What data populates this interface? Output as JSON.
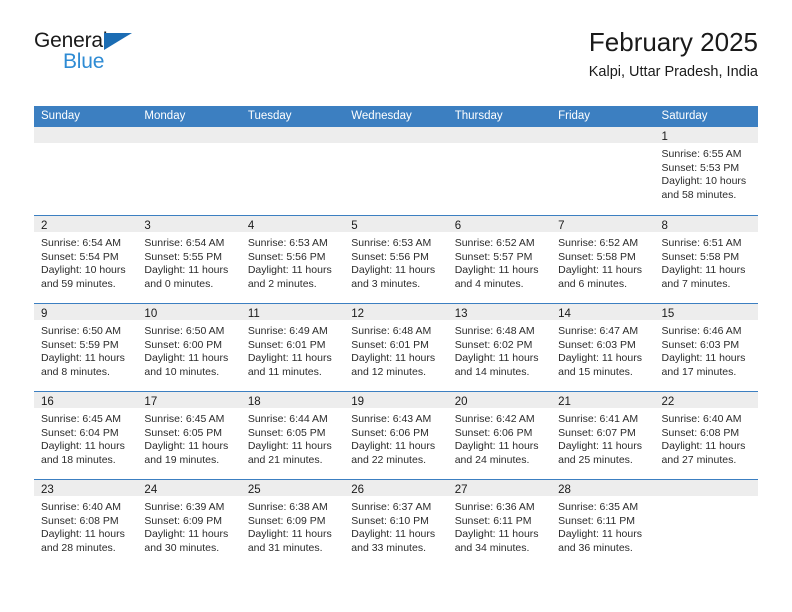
{
  "brand": {
    "name_part1": "General",
    "name_part2": "Blue",
    "triangle_icon": "blue-triangle-icon",
    "accent_color": "#2e8bd4",
    "dark_color": "#1a1a1a"
  },
  "header": {
    "title": "February 2025",
    "subtitle": "Kalpi, Uttar Pradesh, India"
  },
  "colors": {
    "header_bar": "#3c7fc1",
    "date_band": "#ededed",
    "week_divider": "#3c7fc1",
    "text": "#2b2b2b"
  },
  "weekdays": [
    "Sunday",
    "Monday",
    "Tuesday",
    "Wednesday",
    "Thursday",
    "Friday",
    "Saturday"
  ],
  "weeks": [
    [
      {
        "date": "",
        "sunrise": "",
        "sunset": "",
        "daylight_line1": "",
        "daylight_line2": ""
      },
      {
        "date": "",
        "sunrise": "",
        "sunset": "",
        "daylight_line1": "",
        "daylight_line2": ""
      },
      {
        "date": "",
        "sunrise": "",
        "sunset": "",
        "daylight_line1": "",
        "daylight_line2": ""
      },
      {
        "date": "",
        "sunrise": "",
        "sunset": "",
        "daylight_line1": "",
        "daylight_line2": ""
      },
      {
        "date": "",
        "sunrise": "",
        "sunset": "",
        "daylight_line1": "",
        "daylight_line2": ""
      },
      {
        "date": "",
        "sunrise": "",
        "sunset": "",
        "daylight_line1": "",
        "daylight_line2": ""
      },
      {
        "date": "1",
        "sunrise": "Sunrise: 6:55 AM",
        "sunset": "Sunset: 5:53 PM",
        "daylight_line1": "Daylight: 10 hours",
        "daylight_line2": "and 58 minutes."
      }
    ],
    [
      {
        "date": "2",
        "sunrise": "Sunrise: 6:54 AM",
        "sunset": "Sunset: 5:54 PM",
        "daylight_line1": "Daylight: 10 hours",
        "daylight_line2": "and 59 minutes."
      },
      {
        "date": "3",
        "sunrise": "Sunrise: 6:54 AM",
        "sunset": "Sunset: 5:55 PM",
        "daylight_line1": "Daylight: 11 hours",
        "daylight_line2": "and 0 minutes."
      },
      {
        "date": "4",
        "sunrise": "Sunrise: 6:53 AM",
        "sunset": "Sunset: 5:56 PM",
        "daylight_line1": "Daylight: 11 hours",
        "daylight_line2": "and 2 minutes."
      },
      {
        "date": "5",
        "sunrise": "Sunrise: 6:53 AM",
        "sunset": "Sunset: 5:56 PM",
        "daylight_line1": "Daylight: 11 hours",
        "daylight_line2": "and 3 minutes."
      },
      {
        "date": "6",
        "sunrise": "Sunrise: 6:52 AM",
        "sunset": "Sunset: 5:57 PM",
        "daylight_line1": "Daylight: 11 hours",
        "daylight_line2": "and 4 minutes."
      },
      {
        "date": "7",
        "sunrise": "Sunrise: 6:52 AM",
        "sunset": "Sunset: 5:58 PM",
        "daylight_line1": "Daylight: 11 hours",
        "daylight_line2": "and 6 minutes."
      },
      {
        "date": "8",
        "sunrise": "Sunrise: 6:51 AM",
        "sunset": "Sunset: 5:58 PM",
        "daylight_line1": "Daylight: 11 hours",
        "daylight_line2": "and 7 minutes."
      }
    ],
    [
      {
        "date": "9",
        "sunrise": "Sunrise: 6:50 AM",
        "sunset": "Sunset: 5:59 PM",
        "daylight_line1": "Daylight: 11 hours",
        "daylight_line2": "and 8 minutes."
      },
      {
        "date": "10",
        "sunrise": "Sunrise: 6:50 AM",
        "sunset": "Sunset: 6:00 PM",
        "daylight_line1": "Daylight: 11 hours",
        "daylight_line2": "and 10 minutes."
      },
      {
        "date": "11",
        "sunrise": "Sunrise: 6:49 AM",
        "sunset": "Sunset: 6:01 PM",
        "daylight_line1": "Daylight: 11 hours",
        "daylight_line2": "and 11 minutes."
      },
      {
        "date": "12",
        "sunrise": "Sunrise: 6:48 AM",
        "sunset": "Sunset: 6:01 PM",
        "daylight_line1": "Daylight: 11 hours",
        "daylight_line2": "and 12 minutes."
      },
      {
        "date": "13",
        "sunrise": "Sunrise: 6:48 AM",
        "sunset": "Sunset: 6:02 PM",
        "daylight_line1": "Daylight: 11 hours",
        "daylight_line2": "and 14 minutes."
      },
      {
        "date": "14",
        "sunrise": "Sunrise: 6:47 AM",
        "sunset": "Sunset: 6:03 PM",
        "daylight_line1": "Daylight: 11 hours",
        "daylight_line2": "and 15 minutes."
      },
      {
        "date": "15",
        "sunrise": "Sunrise: 6:46 AM",
        "sunset": "Sunset: 6:03 PM",
        "daylight_line1": "Daylight: 11 hours",
        "daylight_line2": "and 17 minutes."
      }
    ],
    [
      {
        "date": "16",
        "sunrise": "Sunrise: 6:45 AM",
        "sunset": "Sunset: 6:04 PM",
        "daylight_line1": "Daylight: 11 hours",
        "daylight_line2": "and 18 minutes."
      },
      {
        "date": "17",
        "sunrise": "Sunrise: 6:45 AM",
        "sunset": "Sunset: 6:05 PM",
        "daylight_line1": "Daylight: 11 hours",
        "daylight_line2": "and 19 minutes."
      },
      {
        "date": "18",
        "sunrise": "Sunrise: 6:44 AM",
        "sunset": "Sunset: 6:05 PM",
        "daylight_line1": "Daylight: 11 hours",
        "daylight_line2": "and 21 minutes."
      },
      {
        "date": "19",
        "sunrise": "Sunrise: 6:43 AM",
        "sunset": "Sunset: 6:06 PM",
        "daylight_line1": "Daylight: 11 hours",
        "daylight_line2": "and 22 minutes."
      },
      {
        "date": "20",
        "sunrise": "Sunrise: 6:42 AM",
        "sunset": "Sunset: 6:06 PM",
        "daylight_line1": "Daylight: 11 hours",
        "daylight_line2": "and 24 minutes."
      },
      {
        "date": "21",
        "sunrise": "Sunrise: 6:41 AM",
        "sunset": "Sunset: 6:07 PM",
        "daylight_line1": "Daylight: 11 hours",
        "daylight_line2": "and 25 minutes."
      },
      {
        "date": "22",
        "sunrise": "Sunrise: 6:40 AM",
        "sunset": "Sunset: 6:08 PM",
        "daylight_line1": "Daylight: 11 hours",
        "daylight_line2": "and 27 minutes."
      }
    ],
    [
      {
        "date": "23",
        "sunrise": "Sunrise: 6:40 AM",
        "sunset": "Sunset: 6:08 PM",
        "daylight_line1": "Daylight: 11 hours",
        "daylight_line2": "and 28 minutes."
      },
      {
        "date": "24",
        "sunrise": "Sunrise: 6:39 AM",
        "sunset": "Sunset: 6:09 PM",
        "daylight_line1": "Daylight: 11 hours",
        "daylight_line2": "and 30 minutes."
      },
      {
        "date": "25",
        "sunrise": "Sunrise: 6:38 AM",
        "sunset": "Sunset: 6:09 PM",
        "daylight_line1": "Daylight: 11 hours",
        "daylight_line2": "and 31 minutes."
      },
      {
        "date": "26",
        "sunrise": "Sunrise: 6:37 AM",
        "sunset": "Sunset: 6:10 PM",
        "daylight_line1": "Daylight: 11 hours",
        "daylight_line2": "and 33 minutes."
      },
      {
        "date": "27",
        "sunrise": "Sunrise: 6:36 AM",
        "sunset": "Sunset: 6:11 PM",
        "daylight_line1": "Daylight: 11 hours",
        "daylight_line2": "and 34 minutes."
      },
      {
        "date": "28",
        "sunrise": "Sunrise: 6:35 AM",
        "sunset": "Sunset: 6:11 PM",
        "daylight_line1": "Daylight: 11 hours",
        "daylight_line2": "and 36 minutes."
      },
      {
        "date": "",
        "sunrise": "",
        "sunset": "",
        "daylight_line1": "",
        "daylight_line2": ""
      }
    ]
  ]
}
